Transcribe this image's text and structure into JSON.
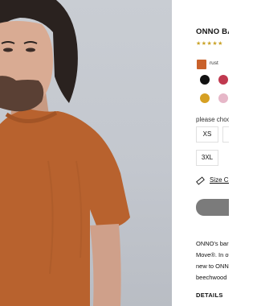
{
  "product": {
    "title": "ONNO BA",
    "rating_stars": "★★★★★",
    "selected_color_name": "rust",
    "selected_color_hex": "#c9612b",
    "color_swatches": [
      "#111111",
      "#c0394f",
      "#d6a023",
      "#e6b7c8"
    ],
    "size_prompt": "please choo",
    "sizes": [
      "XS",
      "3XL"
    ],
    "size_chart_label": "Size Ch",
    "description_lines": [
      "ONNO's bar",
      "Move®. In ot",
      "new to ONN",
      "beechwood"
    ],
    "details_heading": "DETAILS"
  },
  "colors": {
    "shirt": "#b8622e",
    "background": "#c7cbd1",
    "button_gray": "#7b7b7b"
  },
  "icons": {
    "size_chart": "ruler-icon"
  }
}
